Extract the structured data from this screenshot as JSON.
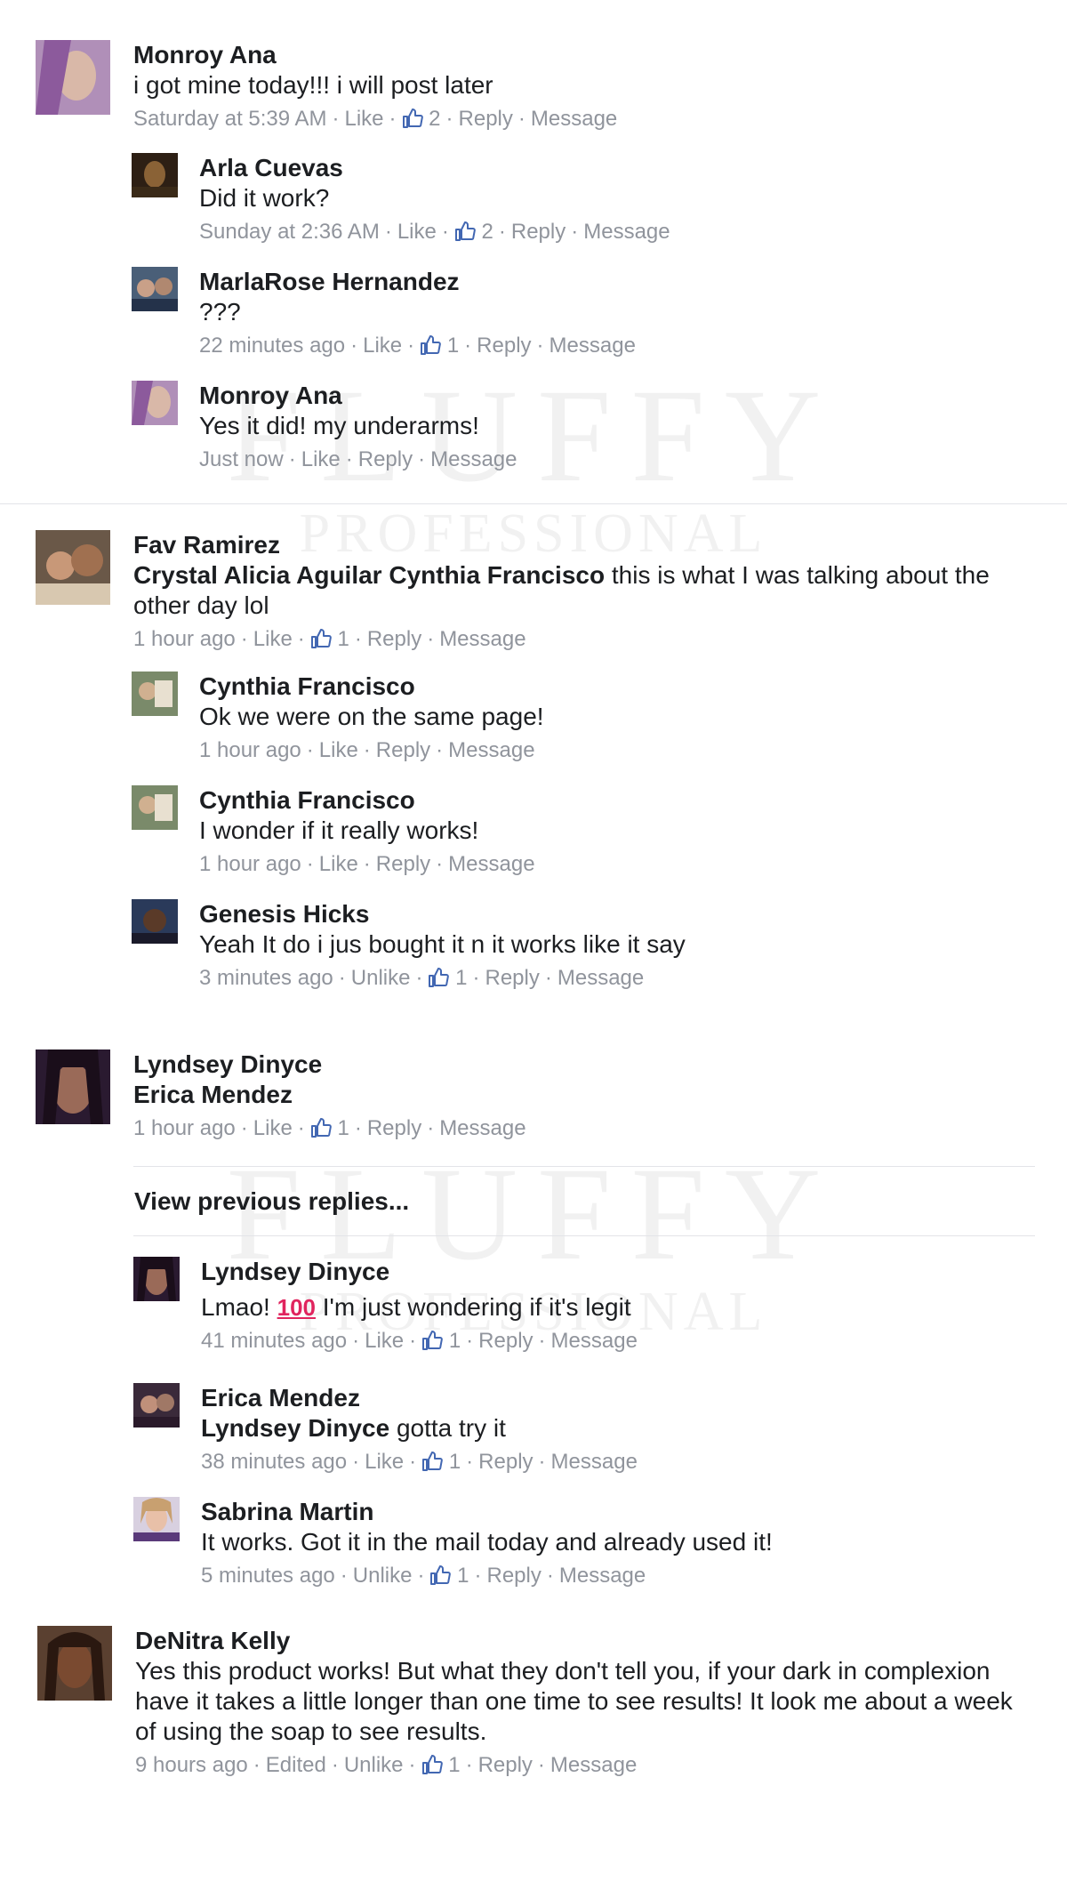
{
  "watermark": {
    "big": "FLUFFY",
    "small": "PROFESSIONAL"
  },
  "meta_labels": {
    "like": "Like",
    "unlike": "Unlike",
    "reply": "Reply",
    "message": "Message",
    "edited": "Edited",
    "sep": "·"
  },
  "view_previous": "View previous replies...",
  "threads": [
    {
      "comment": {
        "name": "Monroy Ana",
        "text": "i got mine today!!! i will post later",
        "time": "Saturday at 5:39 AM",
        "likes": "2"
      },
      "replies": [
        {
          "name": "Arla Cuevas",
          "text": "Did it work?",
          "time": "Sunday at 2:36 AM",
          "likes": "2"
        },
        {
          "name": "MarlaRose Hernandez",
          "text": "???",
          "time": "22 minutes ago",
          "likes": "1"
        },
        {
          "name": "Monroy Ana",
          "text": "Yes it did! my underarms!",
          "time": "Just now"
        }
      ]
    },
    {
      "comment": {
        "name": "Fav Ramirez",
        "tag": "Crystal Alicia Aguilar Cynthia Francisco",
        "text": " this is what I was talking about the other day lol",
        "time": "1 hour ago",
        "likes": "1"
      },
      "replies": [
        {
          "name": "Cynthia Francisco",
          "text": "Ok we were on the same page!",
          "time": "1 hour ago"
        },
        {
          "name": "Cynthia Francisco",
          "text": "I wonder if it really works!",
          "time": "1 hour ago"
        },
        {
          "name": "Genesis Hicks",
          "text": "Yeah It do i jus bought it n it works like it say",
          "time": "3 minutes ago",
          "likes": "1"
        }
      ]
    },
    {
      "comment": {
        "name": "Lyndsey Dinyce",
        "tag": "Erica Mendez",
        "time": "1 hour ago",
        "likes": "1"
      },
      "replies": [
        {
          "name": "Lyndsey Dinyce",
          "text_pre": "Lmao! ",
          "emoji": "100",
          "text_post": " I'm just wondering if it's legit",
          "time": "41 minutes ago",
          "likes": "1"
        },
        {
          "name": "Erica Mendez",
          "tag": "Lyndsey Dinyce",
          "text": "  gotta try it",
          "time": "38 minutes ago",
          "likes": "1"
        },
        {
          "name": "Sabrina Martin",
          "text": "It works. Got it in the mail today and already used it!",
          "time": "5 minutes ago",
          "likes": "1"
        }
      ]
    },
    {
      "comment": {
        "name": "DeNitra Kelly",
        "text": "Yes this product works!  But what they don't tell you, if your dark in complexion have it takes a little longer than one time to see results!  It look me about a week of using the soap to see results.",
        "time": "9 hours ago",
        "likes": "1"
      }
    }
  ],
  "colors": {
    "accent": "#4267b2",
    "meta": "#90949c",
    "text": "#1c1e21"
  }
}
